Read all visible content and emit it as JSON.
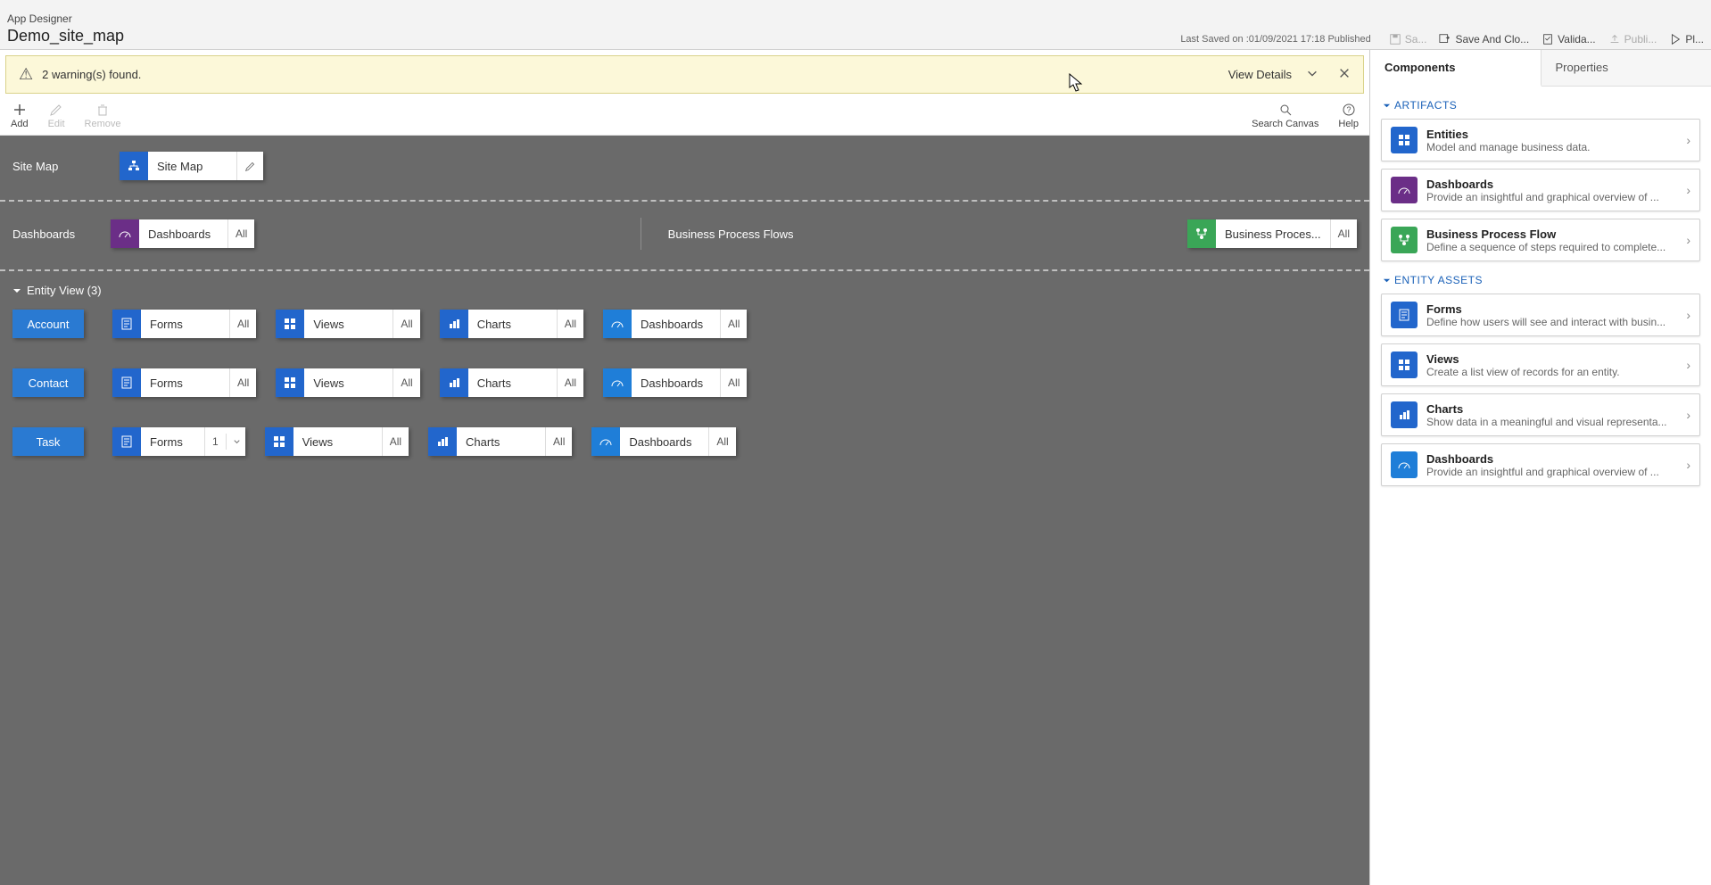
{
  "header": {
    "app_title": "App Designer",
    "app_name": "Demo_site_map",
    "last_saved": "Last Saved on :01/09/2021 17:18 Published",
    "actions": {
      "save": "Sa...",
      "save_close": "Save And Clo...",
      "validate": "Valida...",
      "publish": "Publi...",
      "play": "Pl..."
    }
  },
  "warning": {
    "message": "2 warning(s) found.",
    "view_details": "View Details"
  },
  "toolbar": {
    "add": "Add",
    "edit": "Edit",
    "remove": "Remove",
    "search": "Search Canvas",
    "help": "Help"
  },
  "canvas": {
    "sitemap_label": "Site Map",
    "sitemap_tile": "Site Map",
    "dashboards_label": "Dashboards",
    "dashboards_tile": "Dashboards",
    "bpf_label": "Business Process Flows",
    "bpf_tile": "Business Proces...",
    "all": "All",
    "entity_view_header": "Entity View (3)",
    "entities": [
      {
        "name": "Account",
        "forms_count": "All"
      },
      {
        "name": "Contact",
        "forms_count": "All"
      },
      {
        "name": "Task",
        "forms_count": "1"
      }
    ],
    "asset_labels": {
      "forms": "Forms",
      "views": "Views",
      "charts": "Charts",
      "dashboards": "Dashboards"
    }
  },
  "panel": {
    "tab_components": "Components",
    "tab_properties": "Properties",
    "group_artifacts": "ARTIFACTS",
    "group_entity_assets": "ENTITY ASSETS",
    "artifacts": [
      {
        "title": "Entities",
        "desc": "Model and manage business data.",
        "color": "blue",
        "icon": "grid"
      },
      {
        "title": "Dashboards",
        "desc": "Provide an insightful and graphical overview of ...",
        "color": "purple",
        "icon": "gauge"
      },
      {
        "title": "Business Process Flow",
        "desc": "Define a sequence of steps required to complete...",
        "color": "green",
        "icon": "flow"
      }
    ],
    "entity_assets": [
      {
        "title": "Forms",
        "desc": "Define how users will see and interact with busin...",
        "color": "blue",
        "icon": "form"
      },
      {
        "title": "Views",
        "desc": "Create a list view of records for an entity.",
        "color": "blue",
        "icon": "grid"
      },
      {
        "title": "Charts",
        "desc": "Show data in a meaningful and visual representa...",
        "color": "blue",
        "icon": "chart"
      },
      {
        "title": "Dashboards",
        "desc": "Provide an insightful and graphical overview of ...",
        "color": "blue2",
        "icon": "gauge"
      }
    ]
  }
}
